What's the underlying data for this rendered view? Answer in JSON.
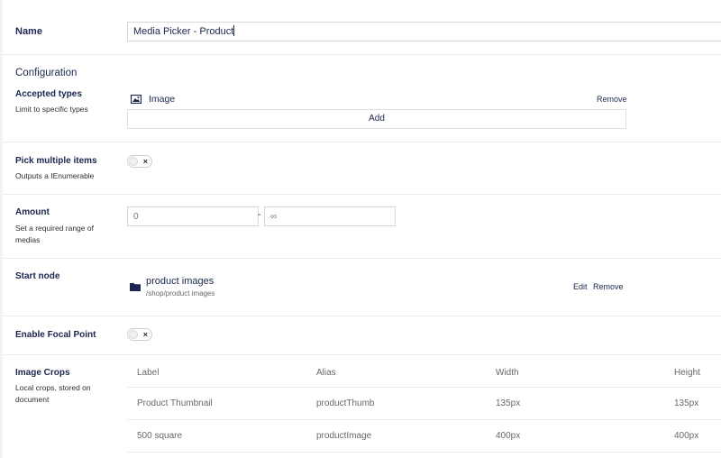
{
  "name": {
    "label": "Name",
    "value": "Media Picker - Product"
  },
  "configuration": {
    "heading": "Configuration"
  },
  "accepted_types": {
    "label": "Accepted types",
    "description": "Limit to specific types",
    "items": [
      {
        "icon": "image-icon",
        "name": "Image",
        "remove_label": "Remove"
      }
    ],
    "add_label": "Add"
  },
  "pick_multiple": {
    "label": "Pick multiple items",
    "description": "Outputs a IEnumerable",
    "toggle_symbol": "×"
  },
  "amount": {
    "label": "Amount",
    "description": "Set a required range of medias",
    "min_placeholder": "0",
    "separator": "-",
    "max_placeholder": "∞"
  },
  "start_node": {
    "label": "Start node",
    "icon": "folder-icon",
    "title": "product images",
    "path": "/shop/product images",
    "edit_label": "Edit",
    "remove_label": "Remove"
  },
  "focal_point": {
    "label": "Enable Focal Point",
    "toggle_symbol": "×"
  },
  "image_crops": {
    "label": "Image Crops",
    "description": "Local crops, stored on document",
    "columns": [
      "Label",
      "Alias",
      "Width",
      "Height"
    ],
    "rows": [
      [
        "Product Thumbnail",
        "productThumb",
        "135px",
        "135px"
      ],
      [
        "500 square",
        "productImage",
        "400px",
        "400px"
      ]
    ]
  }
}
